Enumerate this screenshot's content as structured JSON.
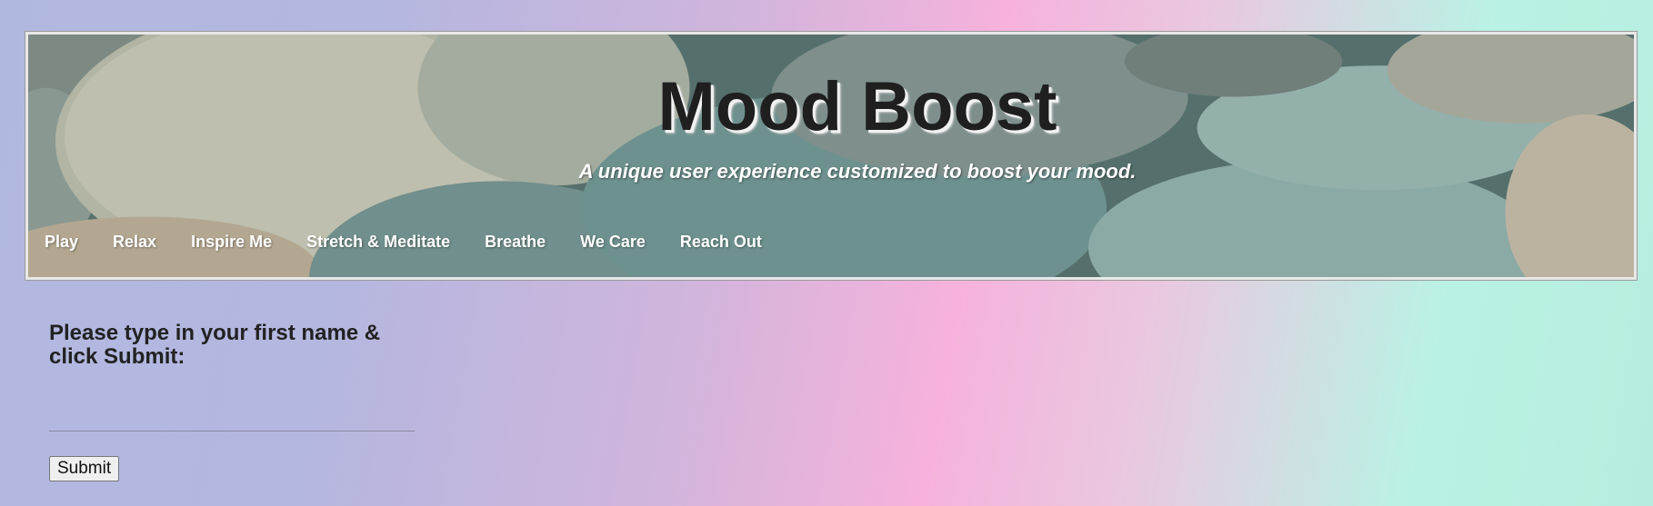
{
  "header": {
    "title": "Mood Boost",
    "subtitle": "A unique user experience customized to boost your mood.",
    "background_image": "stones-photo"
  },
  "nav": {
    "items": [
      {
        "label": "Play"
      },
      {
        "label": "Relax"
      },
      {
        "label": "Inspire Me"
      },
      {
        "label": "Stretch & Meditate"
      },
      {
        "label": "Breathe"
      },
      {
        "label": "We Care"
      },
      {
        "label": "Reach Out"
      }
    ]
  },
  "form": {
    "prompt": "Please type in your first name & click Submit:",
    "name_value": "",
    "name_placeholder": "",
    "submit_label": "Submit"
  },
  "colors": {
    "title": "#1f1f1f",
    "nav_text": "#ffffff",
    "gradient_left": "#b1b8e0",
    "gradient_mid": "#f6b2dc",
    "gradient_right": "#b9f2e4"
  }
}
